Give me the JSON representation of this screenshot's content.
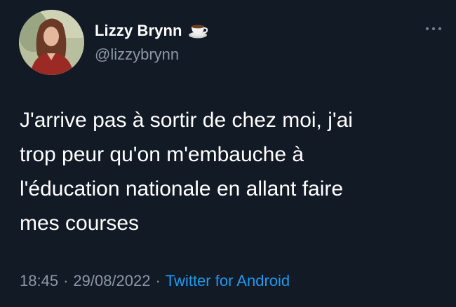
{
  "author": {
    "display_name": "Lizzy Brynn",
    "handle": "@lizzybrynn",
    "emoji_icon": "coffee-cup-icon"
  },
  "tweet": {
    "lines": [
      "J'arrive pas à sortir de chez moi, j'ai",
      "trop peur qu'on m'embauche à",
      "l'éducation nationale en allant faire",
      "mes courses"
    ]
  },
  "meta": {
    "time": "18:45",
    "date": "29/08/2022",
    "separator": "·",
    "source": "Twitter for Android"
  },
  "colors": {
    "background": "#121a25",
    "text": "#ffffff",
    "secondary": "#8b98a5",
    "link": "#1d9bf0"
  },
  "icons": {
    "more": "more-options-icon"
  }
}
